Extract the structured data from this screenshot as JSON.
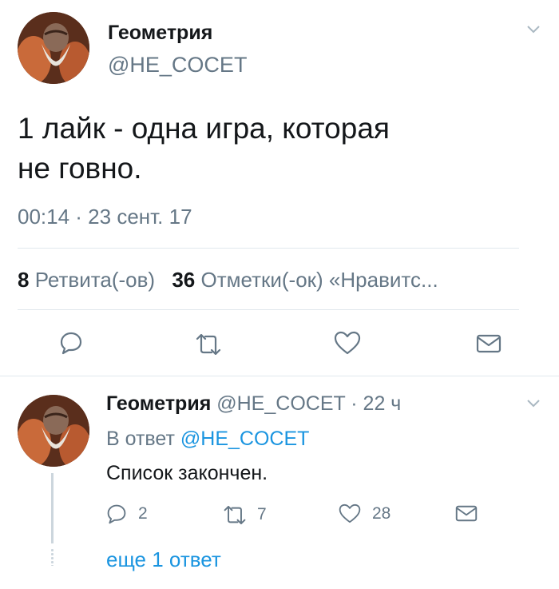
{
  "main_tweet": {
    "author_name": "Геометрия",
    "handle": "@HE_COCET",
    "text_line1": "1 лайк - одна игра, которая",
    "text_line2": "не говно.",
    "timestamp": "00:14 · 23 сент. 17",
    "retweet_count": "8",
    "retweet_label": "Ретвита(-ов)",
    "like_count": "36",
    "like_label": "Отметки(-ок) «Нравитс..."
  },
  "reply_tweet": {
    "author_name": "Геометрия",
    "handle": "@HE_COCET",
    "time": "· 22 ч",
    "reply_prefix": "В ответ",
    "reply_to": "@HE_COCET",
    "text": "Список закончен.",
    "reply_count": "2",
    "retweet_count": "7",
    "like_count": "28"
  },
  "more_replies": "еще 1 ответ",
  "colors": {
    "link": "#1b95e0",
    "secondary": "#657786",
    "icon": "#657786",
    "divider": "#e1e8ed"
  },
  "icons": [
    "chevron-down-icon",
    "reply-icon",
    "retweet-icon",
    "like-icon",
    "message-icon"
  ]
}
